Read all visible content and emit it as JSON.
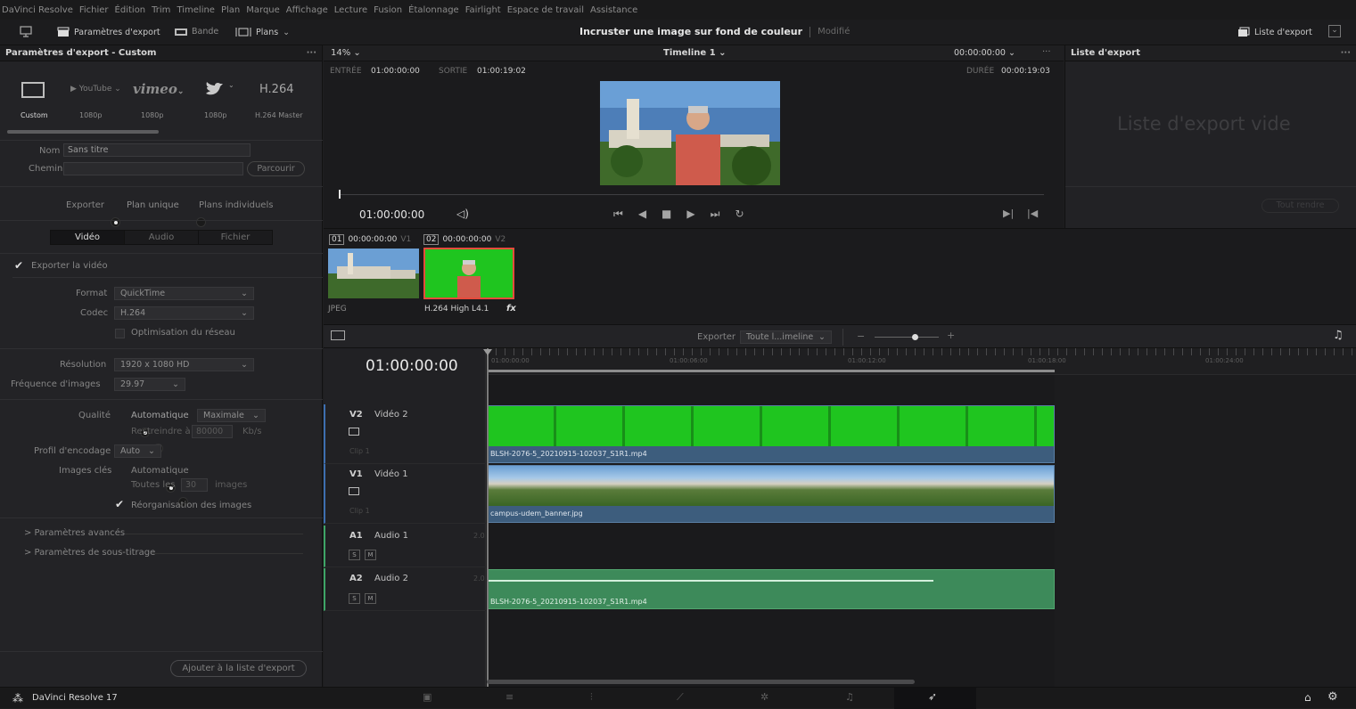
{
  "menu": [
    "DaVinci Resolve",
    "Fichier",
    "Édition",
    "Trim",
    "Timeline",
    "Plan",
    "Marque",
    "Affichage",
    "Lecture",
    "Fusion",
    "Étalonnage",
    "Fairlight",
    "Espace de travail",
    "Assistance"
  ],
  "toolbar": {
    "render_settings": "Paramètres d'export",
    "clip_strip": "Bande",
    "clips_menu": "Plans",
    "project_title": "Incruster une image sur fond de couleur",
    "project_status": "Modifié",
    "render_queue": "Liste d'export"
  },
  "left_panel": {
    "title": "Paramètres d'export - Custom",
    "presets": [
      {
        "name": "Custom",
        "sub": "Custom"
      },
      {
        "name": "YouTube",
        "sub": "1080p"
      },
      {
        "name": "vimeo",
        "sub": "1080p"
      },
      {
        "name": "twitter",
        "sub": "1080p"
      },
      {
        "name": "H.264",
        "sub": "H.264 Master"
      }
    ],
    "name_label": "Nom",
    "name_value": "Sans titre",
    "path_label": "Chemin",
    "path_value": "",
    "browse": "Parcourir",
    "export_label": "Exporter",
    "single_clip": "Plan unique",
    "individual_clips": "Plans individuels",
    "tabs": [
      "Vidéo",
      "Audio",
      "Fichier"
    ],
    "export_video": "Exporter la vidéo",
    "format_label": "Format",
    "format_value": "QuickTime",
    "codec_label": "Codec",
    "codec_value": "H.264",
    "network_opt": "Optimisation du réseau",
    "resolution_label": "Résolution",
    "resolution_value": "1920 x 1080 HD",
    "framerate_label": "Fréquence d'images",
    "framerate_value": "29.97",
    "quality_label": "Qualité",
    "quality_auto": "Automatique",
    "quality_value": "Maximale",
    "restrict_label": "Restreindre à",
    "restrict_value": "80000",
    "restrict_unit": "Kb/s",
    "encoding_label": "Profil d'encodage",
    "encoding_value": "Auto",
    "keyframes_label": "Images clés",
    "keyframes_auto": "Automatique",
    "keyframes_every": "Toutes les",
    "keyframes_value": "30",
    "keyframes_unit": "images",
    "reorder": "Réorganisation des images",
    "advanced": "> Paramètres avancés",
    "subtitles": "> Paramètres de sous-titrage",
    "add_queue": "Ajouter à la liste d'export"
  },
  "viewer": {
    "zoom": "14%",
    "timeline_name": "Timeline 1",
    "timecode_top": "00:00:00:00",
    "in_label": "ENTRÉE",
    "in_value": "01:00:00:00",
    "out_label": "SORTIE",
    "out_value": "01:00:19:02",
    "dur_label": "DURÉE",
    "dur_value": "00:00:19:03",
    "current_tc": "01:00:00:00"
  },
  "export_list": {
    "title": "Liste d'export",
    "empty": "Liste d'export vide",
    "render_all": "Tout rendre"
  },
  "clips": [
    {
      "num": "01",
      "tc": "00:00:00:00",
      "track": "V1",
      "label": "JPEG"
    },
    {
      "num": "02",
      "tc": "00:00:00:00",
      "track": "V2",
      "label": "H.264 High L4.1",
      "fx": "fx"
    }
  ],
  "timeline_bar": {
    "export_label": "Exporter",
    "range_value": "Toute l...imeline"
  },
  "timeline": {
    "current_tc": "01:00:00:00",
    "ruler": [
      "01:00:00:00",
      "01:00:06:00",
      "01:00:12:00",
      "01:00:18:00",
      "01:00:24:00"
    ],
    "tracks": [
      {
        "id": "V2",
        "name": "Vidéo 2",
        "sub": "Clip 1",
        "clip": "BLSH-2076-5_20210915-102037_S1R1.mp4"
      },
      {
        "id": "V1",
        "name": "Vidéo 1",
        "sub": "Clip 1",
        "clip": "campus-udem_banner.jpg"
      },
      {
        "id": "A1",
        "name": "Audio 1",
        "ch": "2.0"
      },
      {
        "id": "A2",
        "name": "Audio 2",
        "ch": "2.0",
        "clip": "BLSH-2076-5_20210915-102037_S1R1.mp4"
      }
    ],
    "solo": "S",
    "mute": "M"
  },
  "status": {
    "app": "DaVinci Resolve 17"
  },
  "colors": {
    "accent": "#e64b3c",
    "video_clip": "#3d5d7d",
    "audio_clip": "#3d8a5a",
    "green_screen": "#1fc51f"
  }
}
